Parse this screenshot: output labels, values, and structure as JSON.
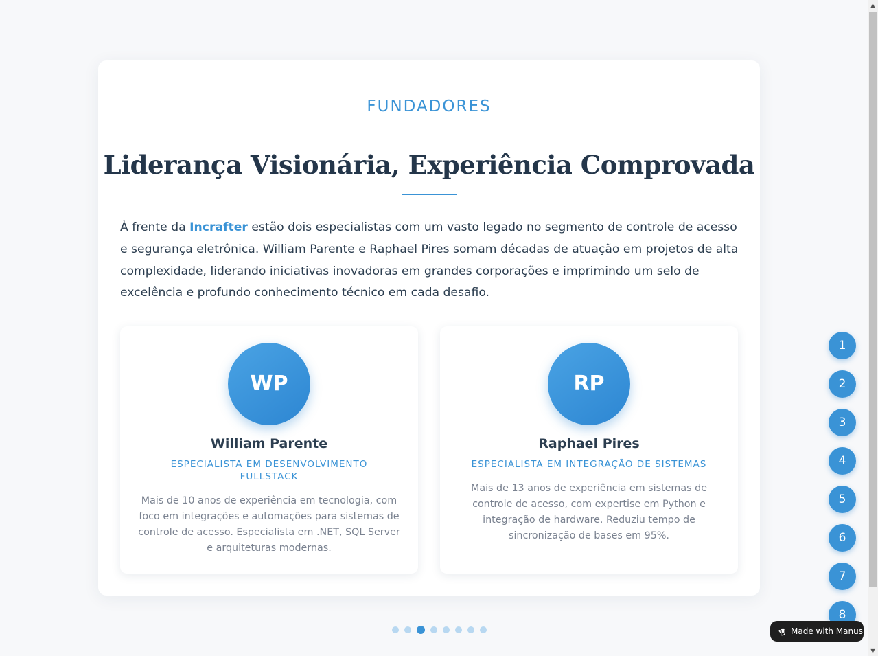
{
  "section": {
    "eyebrow": "FUNDADORES",
    "headline": "Liderança Visionária, Experiência Comprovada",
    "intro_prefix": "À frente da ",
    "intro_brand": "Incrafter",
    "intro_suffix": " estão dois especialistas com um vasto legado no segmento de controle de acesso e segurança eletrônica. William Parente e Raphael Pires somam décadas de atuação em projetos de alta complexidade, liderando iniciativas inovadoras em grandes corporações e imprimindo um selo de excelência e profundo conhecimento técnico em cada desafio."
  },
  "founders": [
    {
      "initials": "WP",
      "name": "William Parente",
      "role": "ESPECIALISTA EM DESENVOLVIMENTO FULLSTACK",
      "bio": "Mais de 10 anos de experiência em tecnologia, com foco em integrações e automações para sistemas de controle de acesso. Especialista em .NET, SQL Server e arquiteturas modernas."
    },
    {
      "initials": "RP",
      "name": "Raphael Pires",
      "role": "ESPECIALISTA EM INTEGRAÇÃO DE SISTEMAS",
      "bio": "Mais de 13 anos de experiência em sistemas de controle de acesso, com expertise em Python e integração de hardware. Reduziu tempo de sincronização de bases em 95%."
    }
  ],
  "slide_nav": [
    "1",
    "2",
    "3",
    "4",
    "5",
    "6",
    "7",
    "8"
  ],
  "pagination": {
    "total": 8,
    "active_index": 2
  },
  "badge": {
    "label": "Made with Manus",
    "icon": "manus-hand-icon"
  },
  "colors": {
    "accent": "#3a93d6",
    "heading": "#24364a",
    "text": "#2c3e50",
    "muted": "#7a8290",
    "background": "#f7f8fa"
  }
}
